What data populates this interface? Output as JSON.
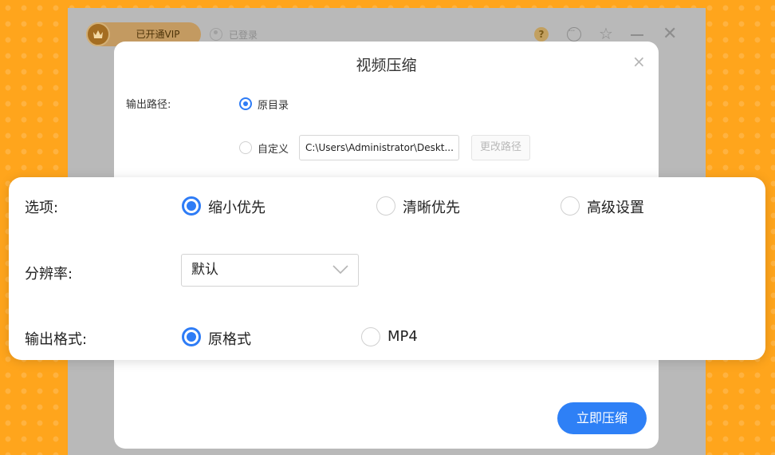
{
  "app": {
    "vip_label": "已开通VIP",
    "user_label": "已登录",
    "help_glyph": "?"
  },
  "dialog": {
    "title": "视频压缩",
    "close_glyph": "×",
    "output_path": {
      "label": "输出路径:",
      "options": [
        {
          "label": "原目录",
          "checked": true
        },
        {
          "label": "自定义",
          "checked": false
        }
      ],
      "custom_path_value": "C:\\Users\\Administrator\\Deskt...",
      "change_button": "更改路径"
    },
    "submit_button": "立即压缩"
  },
  "options_panel": {
    "option": {
      "label": "选项:",
      "choices": [
        {
          "label": "缩小优先",
          "checked": true
        },
        {
          "label": "清晰优先",
          "checked": false
        },
        {
          "label": "高级设置",
          "checked": false
        }
      ]
    },
    "resolution": {
      "label": "分辨率:",
      "selected": "默认"
    },
    "format": {
      "label": "输出格式:",
      "choices": [
        {
          "label": "原格式",
          "checked": true
        },
        {
          "label": "MP4",
          "checked": false
        }
      ]
    }
  },
  "colors": {
    "accent": "#2e7cf6",
    "background": "#ffa51c",
    "vip_gold": "#c39a61"
  }
}
